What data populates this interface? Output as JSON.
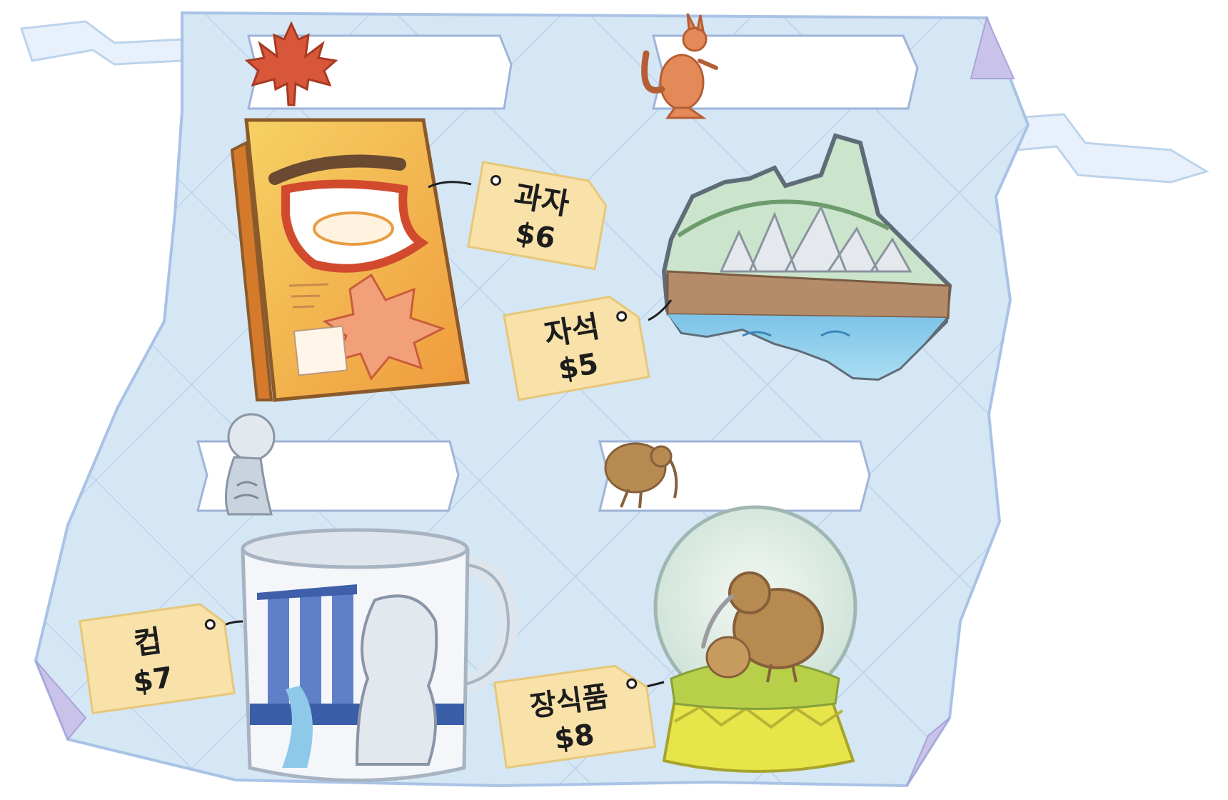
{
  "colors": {
    "cloth": "#d5e6f4",
    "cloth_border": "#a9c3e6",
    "tag_fill": "#f8e2aa",
    "tag_border": "#e7c77a",
    "label_fill": "#ffffff",
    "label_border": "#9fb4d8"
  },
  "countries": [
    {
      "icon": "maple-leaf-icon"
    },
    {
      "icon": "kangaroo-icon"
    },
    {
      "icon": "merlion-icon"
    },
    {
      "icon": "kiwi-bird-icon"
    }
  ],
  "items": [
    {
      "name": "과자",
      "price": "$6",
      "image": "maple-cookie-box"
    },
    {
      "name": "자석",
      "price": "$5",
      "image": "australia-magnet"
    },
    {
      "name": "컵",
      "price": "$7",
      "image": "merlion-mug"
    },
    {
      "name": "장식품",
      "price": "$8",
      "image": "kiwi-snow-globe"
    }
  ]
}
